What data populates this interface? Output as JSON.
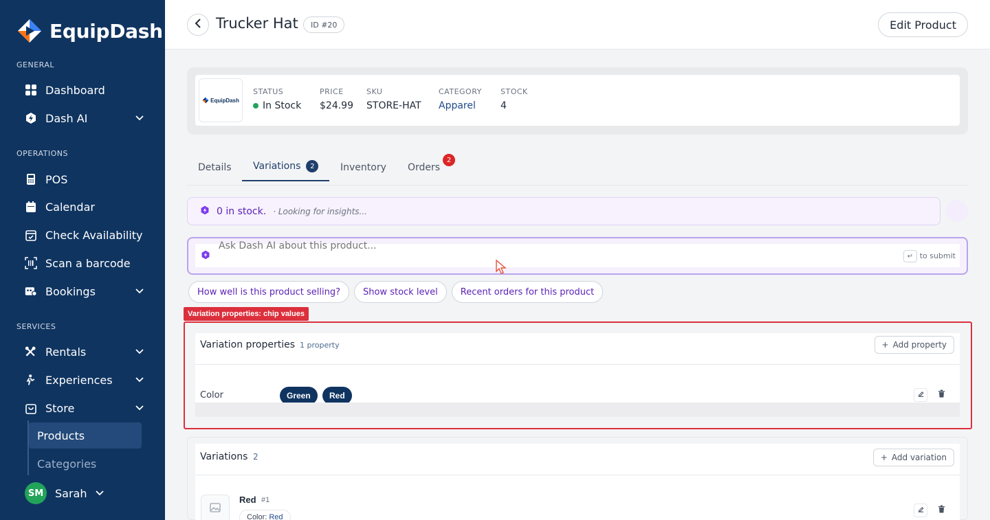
{
  "brand": {
    "name": "EquipDash"
  },
  "sidebar": {
    "sections": [
      {
        "label": "GENERAL"
      },
      {
        "label": "OPERATIONS"
      },
      {
        "label": "SERVICES"
      }
    ],
    "items": [
      {
        "label": "Dashboard",
        "icon": "grid-icon"
      },
      {
        "label": "Dash AI",
        "icon": "shield-bolt-icon",
        "expandable": true
      },
      {
        "label": "POS",
        "icon": "pos-terminal-icon"
      },
      {
        "label": "Calendar",
        "icon": "calendar-icon"
      },
      {
        "label": "Check Availability",
        "icon": "calendar-check-icon"
      },
      {
        "label": "Scan a barcode",
        "icon": "barcode-icon"
      },
      {
        "label": "Bookings",
        "icon": "bookings-icon",
        "expandable": true
      },
      {
        "label": "Rentals",
        "icon": "tools-icon",
        "expandable": true
      },
      {
        "label": "Experiences",
        "icon": "person-activity-icon",
        "expandable": true
      },
      {
        "label": "Store",
        "icon": "shopping-bag-icon",
        "expandable": true
      }
    ],
    "store_sub": [
      {
        "label": "Products",
        "active": true
      },
      {
        "label": "Categories",
        "active": false
      }
    ],
    "user": {
      "initials": "SM",
      "name": "Sarah"
    }
  },
  "header": {
    "title": "Trucker Hat",
    "id_badge": "ID #20",
    "edit_button": "Edit Product"
  },
  "summary": {
    "logo_text": "EquipDash",
    "status": {
      "label": "STATUS",
      "value": "In Stock"
    },
    "price": {
      "label": "PRICE",
      "value": "$24.99"
    },
    "sku": {
      "label": "SKU",
      "value": "STORE-HAT"
    },
    "category": {
      "label": "CATEGORY",
      "value": "Apparel"
    },
    "stock": {
      "label": "STOCK",
      "value": "4"
    }
  },
  "tabs": [
    {
      "label": "Details"
    },
    {
      "label": "Variations",
      "badge": "2",
      "active": true
    },
    {
      "label": "Inventory"
    },
    {
      "label": "Orders",
      "badge": "2"
    }
  ],
  "insight": {
    "main": "0 in stock.",
    "sub": "· Looking for insights..."
  },
  "ask": {
    "placeholder": "Ask Dash AI about this product...",
    "enter_key": "↵",
    "submit_hint": "to submit"
  },
  "suggestions": [
    "How well is this product selling?",
    "Show stock level",
    "Recent orders for this product"
  ],
  "annotation": {
    "label": "Variation properties: chip values"
  },
  "variation_properties": {
    "title": "Variation properties",
    "count": "1 property",
    "add_button": "Add property",
    "rows": [
      {
        "name": "Color",
        "values": [
          "Green",
          "Red"
        ]
      }
    ]
  },
  "variations": {
    "title": "Variations",
    "count": "2",
    "add_button": "Add variation",
    "items": [
      {
        "name": "Red",
        "number": "#1",
        "attr_label": "Color:",
        "attr_value": "Red"
      }
    ]
  },
  "colors": {
    "sidebar": "#0f3460",
    "accent": "#1f3f6b",
    "ai_purple": "#5b21b6",
    "in_stock": "#22a35a",
    "badge_red": "#dc2626",
    "annotation": "#dc2f3c"
  }
}
